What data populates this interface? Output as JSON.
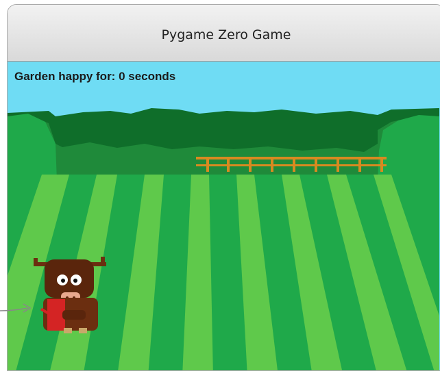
{
  "window": {
    "title": "Pygame Zero Game"
  },
  "hud": {
    "status_text": "Garden happy for: 0 seconds",
    "seconds_happy": 0
  },
  "colors": {
    "sky": "#6fdcf4",
    "stripe_light": "#5fc94b",
    "stripe_dark": "#1fa94a",
    "tree_dark": "#0f6e2a",
    "tree_mid": "#1f8a3a",
    "fence": "#d98a20",
    "cow_body": "#6b2e10",
    "watering_can": "#d42424"
  },
  "sprites": {
    "player": "cow-holding-watering-can",
    "scenery": [
      "tree-line",
      "wooden-fence",
      "striped-field"
    ]
  }
}
